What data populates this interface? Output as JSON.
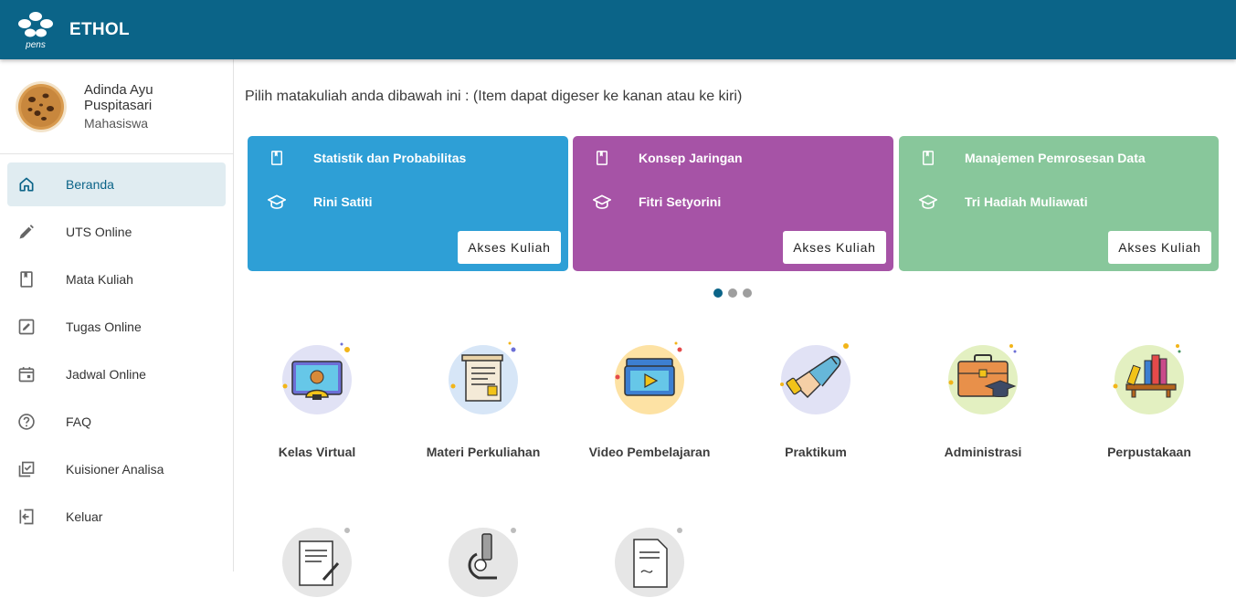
{
  "app": {
    "title": "ETHOL",
    "logo_text": "pens"
  },
  "user": {
    "name": "Adinda Ayu Puspitasari",
    "role": "Mahasiswa"
  },
  "sidebar": {
    "items": [
      {
        "label": "Beranda",
        "icon": "home-icon",
        "active": true
      },
      {
        "label": "UTS Online",
        "icon": "pencil-icon"
      },
      {
        "label": "Mata Kuliah",
        "icon": "book-icon"
      },
      {
        "label": "Tugas Online",
        "icon": "edit-square-icon"
      },
      {
        "label": "Jadwal Online",
        "icon": "calendar-icon"
      },
      {
        "label": "FAQ",
        "icon": "help-circle-icon"
      },
      {
        "label": "Kuisioner Analisa",
        "icon": "checklist-icon"
      },
      {
        "label": "Keluar",
        "icon": "logout-icon"
      }
    ]
  },
  "main": {
    "instruction": "Pilih matakuliah anda dibawah ini : (Item dapat digeser ke kanan atau ke kiri)",
    "courses": [
      {
        "course": "Statistik dan Probabilitas",
        "lecturer": "Rini Satiti",
        "button": "Akses Kuliah",
        "color": "#2e9fd6"
      },
      {
        "course": "Konsep Jaringan",
        "lecturer": "Fitri Setyorini",
        "button": "Akses Kuliah",
        "color": "#a653a6"
      },
      {
        "course": "Manajemen Pemrosesan Data",
        "lecturer": "Tri Hadiah Muliawati",
        "button": "Akses Kuliah",
        "color": "#88c79b"
      }
    ],
    "carousel": {
      "pages": 3,
      "active": 1
    },
    "menu": [
      {
        "label": "Kelas Virtual",
        "icon": "virtual-class-icon",
        "bg": "#e1e2f5"
      },
      {
        "label": "Materi Perkuliahan",
        "icon": "course-material-icon",
        "bg": "#d7e6f7"
      },
      {
        "label": "Video Pembelajaran",
        "icon": "video-learning-icon",
        "bg": "#fde2a4"
      },
      {
        "label": "Praktikum",
        "icon": "practicum-icon",
        "bg": "#e1e2f5"
      },
      {
        "label": "Administrasi",
        "icon": "administration-icon",
        "bg": "#e3f0c1"
      },
      {
        "label": "Perpustakaan",
        "icon": "library-icon",
        "bg": "#e3f0c1"
      }
    ],
    "menu_partial": [
      {
        "icon": "document-edit-icon"
      },
      {
        "icon": "microscope-icon"
      },
      {
        "icon": "certificate-icon"
      }
    ]
  }
}
